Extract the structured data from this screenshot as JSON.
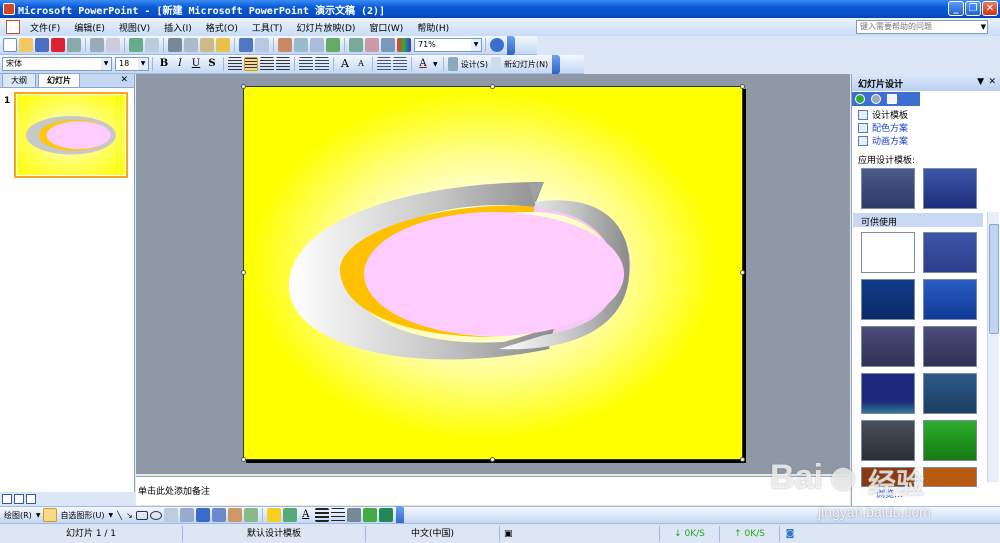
{
  "window": {
    "title": "Microsoft PowerPoint - [新建 Microsoft PowerPoint 演示文稿 (2)]",
    "min": "_",
    "restore": "❐",
    "close": "✕"
  },
  "menu": {
    "items": [
      "文件(F)",
      "编辑(E)",
      "视图(V)",
      "插入(I)",
      "格式(O)",
      "工具(T)",
      "幻灯片放映(D)",
      "窗口(W)",
      "帮助(H)"
    ],
    "help_placeholder": "键入需要帮助的问题"
  },
  "standard_toolbar": {
    "zoom": "71%"
  },
  "format_toolbar": {
    "font": "宋体",
    "size": "18",
    "bold": "B",
    "italic": "I",
    "underline": "U",
    "shadow": "S",
    "font_color": "A",
    "design": "设计(S)",
    "new_slide": "新幻灯片(N)"
  },
  "left_pane": {
    "tabs": [
      "大纲",
      "幻灯片"
    ],
    "close": "✕",
    "slide_number": "1"
  },
  "notes": {
    "placeholder": "单击此处添加备注"
  },
  "task_pane": {
    "title": "幻灯片设计",
    "links": [
      "设计模板",
      "配色方案",
      "动画方案"
    ],
    "apply_label": "应用设计模板:",
    "available_label": "可供使用",
    "browse": "浏览..."
  },
  "drawing_toolbar": {
    "draw": "绘图(R)",
    "autoshapes": "自选图形(U)"
  },
  "status": {
    "slide": "幻灯片 1 / 1",
    "design": "默认设计模板",
    "language": "中文(中国)",
    "upload": "0K/S",
    "download": "0K/S"
  },
  "watermark": {
    "brand": "Bai",
    "brand2": "经验",
    "url": "jingyan.baidu.com"
  },
  "colors": {
    "slide_bg": "#ffff00",
    "workspace": "#8e98a6",
    "title_bar": "#0a5ad6"
  }
}
